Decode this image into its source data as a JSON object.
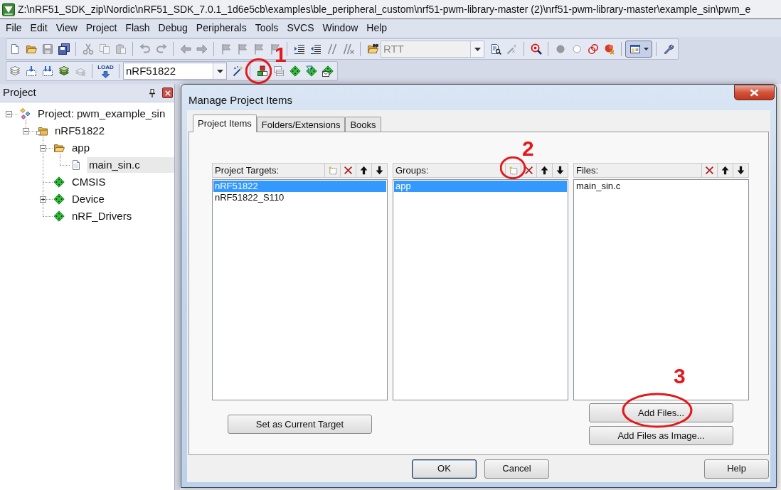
{
  "window": {
    "title": "Z:\\nRF51_SDK_zip\\Nordic\\nRF51_SDK_7.0.1_1d6e5cb\\examples\\ble_peripheral_custom\\nrf51-pwm-library-master (2)\\nrf51-pwm-library-master\\example_sin\\pwm_e"
  },
  "menu": [
    "File",
    "Edit",
    "View",
    "Project",
    "Flash",
    "Debug",
    "Peripherals",
    "Tools",
    "SVCS",
    "Window",
    "Help"
  ],
  "toolbars": [
    {
      "groups": [
        [
          {
            "kind": "new-file",
            "disabled": false
          },
          {
            "kind": "open",
            "disabled": false
          },
          {
            "kind": "save",
            "disabled": true
          },
          {
            "kind": "save-all",
            "disabled": false
          }
        ],
        [
          {
            "kind": "cut",
            "disabled": true
          },
          {
            "kind": "copy",
            "disabled": true
          },
          {
            "kind": "paste",
            "disabled": true
          }
        ],
        [
          {
            "kind": "undo",
            "disabled": true
          },
          {
            "kind": "redo",
            "disabled": true
          }
        ],
        [
          {
            "kind": "back",
            "disabled": true
          },
          {
            "kind": "forward",
            "disabled": true
          }
        ],
        [
          {
            "kind": "bookmark",
            "disabled": true
          },
          {
            "kind": "bookmark",
            "disabled": true
          },
          {
            "kind": "bookmark",
            "disabled": true
          },
          {
            "kind": "bookmark",
            "disabled": true
          }
        ],
        [
          {
            "kind": "indent",
            "disabled": false
          },
          {
            "kind": "outdent",
            "disabled": false
          },
          {
            "kind": "comment",
            "disabled": true
          },
          {
            "kind": "uncomment",
            "disabled": true
          }
        ],
        [
          {
            "kind": "find-in-files",
            "disabled": false
          },
          {
            "kind": "combobox",
            "value": "RTT",
            "disabled": true
          },
          {
            "kind": "source-browse",
            "disabled": false
          },
          {
            "kind": "wand-tool",
            "disabled": true
          }
        ],
        [
          {
            "kind": "debug",
            "disabled": false
          }
        ],
        [
          {
            "kind": "breakpoint",
            "disabled": true
          },
          {
            "kind": "breakpoint-enable",
            "disabled": false
          },
          {
            "kind": "breakpoint-disable-all",
            "disabled": false
          },
          {
            "kind": "breakpoint-kill-all",
            "disabled": false
          }
        ],
        [
          {
            "kind": "layout-menu",
            "disabled": false
          }
        ],
        [
          {
            "kind": "wrench",
            "disabled": false
          }
        ]
      ]
    },
    {
      "groups": [
        [
          {
            "kind": "translate",
            "disabled": false
          },
          {
            "kind": "build",
            "disabled": false
          },
          {
            "kind": "rebuild",
            "disabled": false
          },
          {
            "kind": "batch-build",
            "disabled": false
          },
          {
            "kind": "stop-build",
            "disabled": true
          }
        ],
        [
          {
            "kind": "load",
            "label": "LOAD",
            "disabled": false
          }
        ],
        [
          {
            "kind": "combobox",
            "value": "nRF51822",
            "disabled": false
          },
          {
            "kind": "options",
            "disabled": false
          }
        ],
        [
          {
            "kind": "manage",
            "disabled": false
          },
          {
            "kind": "multi-project",
            "disabled": true
          },
          {
            "kind": "pack-installer",
            "disabled": false
          },
          {
            "kind": "pack-select",
            "disabled": false
          },
          {
            "kind": "pack-mail",
            "disabled": false
          }
        ]
      ]
    }
  ],
  "project_panel": {
    "title": "Project",
    "tree": [
      {
        "kind": "project",
        "label": "Project: pwm_example_sin",
        "expanded": true,
        "selected": false,
        "children": [
          {
            "kind": "target",
            "label": "nRF51822",
            "expanded": true,
            "selected": false,
            "children": [
              {
                "kind": "group",
                "label": "app",
                "expanded": true,
                "selected": false,
                "children": [
                  {
                    "kind": "file",
                    "label": "main_sin.c",
                    "selected": true
                  }
                ]
              },
              {
                "kind": "component",
                "label": "CMSIS",
                "selected": false
              },
              {
                "kind": "component",
                "label": "Device",
                "expanded": false,
                "selected": false
              },
              {
                "kind": "component",
                "label": "nRF_Drivers",
                "selected": false
              }
            ]
          }
        ]
      }
    ]
  },
  "dialog": {
    "title": "Manage Project Items",
    "tabs": [
      {
        "label": "Project Items",
        "selected": true
      },
      {
        "label": "Folders/Extensions",
        "selected": false
      },
      {
        "label": "Books",
        "selected": false
      }
    ],
    "columns": [
      {
        "label": "Project Targets:",
        "tools": [
          {
            "kind": "new"
          },
          {
            "kind": "delete"
          },
          {
            "kind": "up"
          },
          {
            "kind": "down"
          }
        ],
        "items": [
          {
            "text": "nRF51822",
            "selected": true
          },
          {
            "text": "nRF51822_S110",
            "selected": false
          }
        ],
        "buttons": [
          {
            "label": "Set as Current Target"
          }
        ]
      },
      {
        "label": "Groups:",
        "tools": [
          {
            "kind": "new"
          },
          {
            "kind": "delete"
          },
          {
            "kind": "up"
          },
          {
            "kind": "down"
          }
        ],
        "items": [
          {
            "text": "app",
            "selected": true
          }
        ]
      },
      {
        "label": "Files:",
        "tools": [
          {
            "kind": "delete"
          },
          {
            "kind": "up"
          },
          {
            "kind": "down"
          }
        ],
        "items": [
          {
            "text": "main_sin.c",
            "selected": false
          }
        ],
        "buttons": [
          {
            "label": "Add Files..."
          },
          {
            "label": "Add Files as Image..."
          }
        ]
      }
    ],
    "footer_buttons": [
      {
        "label": "OK",
        "default": true
      },
      {
        "label": "Cancel",
        "default": false
      }
    ],
    "help_button": {
      "label": "Help"
    }
  },
  "annotations": [
    {
      "label": "1"
    },
    {
      "label": "2"
    },
    {
      "label": "3"
    }
  ]
}
